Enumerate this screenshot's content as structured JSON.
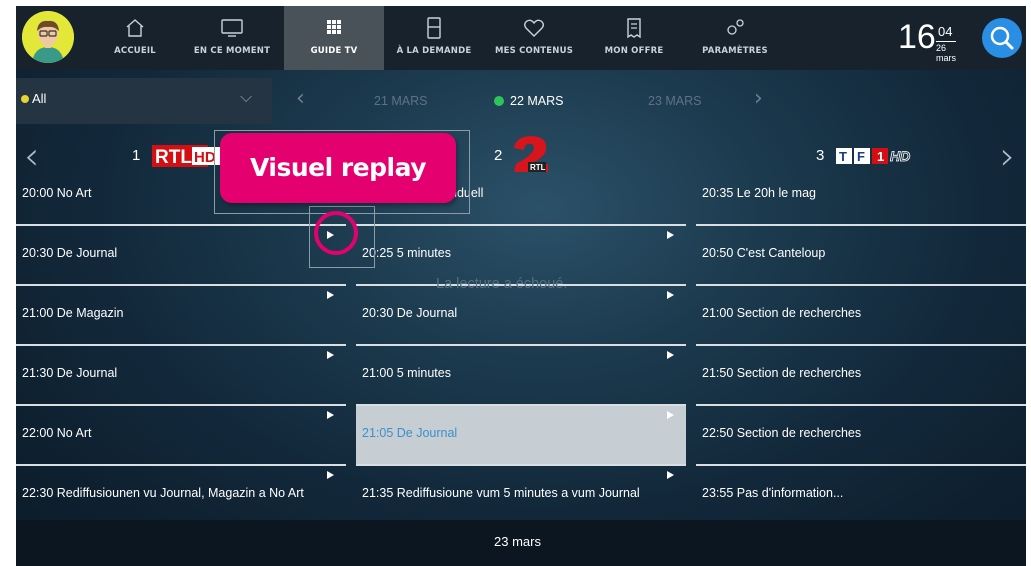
{
  "nav": {
    "items": [
      {
        "label": "ACCUEIL",
        "icon": "home-icon"
      },
      {
        "label": "EN CE MOMENT",
        "icon": "tv-icon"
      },
      {
        "label": "GUIDE TV",
        "icon": "grid-icon",
        "active": true
      },
      {
        "label": "À LA DEMANDE",
        "icon": "film-icon"
      },
      {
        "label": "MES CONTENUS",
        "icon": "heart-icon"
      },
      {
        "label": "MON OFFRE",
        "icon": "receipt-icon"
      },
      {
        "label": "PARAMÈTRES",
        "icon": "gears-icon"
      }
    ],
    "clock": {
      "hours": "16",
      "minutes": "04",
      "date": "26 mars"
    }
  },
  "filter": {
    "value": "All"
  },
  "dates": {
    "prev": "21 MARS",
    "current": "22 MARS",
    "next": "23 MARS"
  },
  "channels": [
    {
      "number": "1",
      "logo": "RTL HD"
    },
    {
      "number": "2",
      "logo": "2 RTL"
    },
    {
      "number": "3",
      "logo": "TF1 HD"
    }
  ],
  "schedule": {
    "col1": [
      {
        "text": "20:00  No Art"
      },
      {
        "text": "20:30  De Journal"
      },
      {
        "text": "21:00  De Magazin"
      },
      {
        "text": "21:30  De Journal"
      },
      {
        "text": "22:00  No Art"
      },
      {
        "text": "22:30  Rediffusiounen vu Journal, Magazin a No Art"
      }
    ],
    "col2": [
      {
        "text": "nduell"
      },
      {
        "text": "20:25  5 minutes"
      },
      {
        "text": "20:30  De Journal"
      },
      {
        "text": "21:00  5 minutes"
      },
      {
        "text": "21:05  De Journal"
      },
      {
        "text": "21:35  Rediffusioune vum 5 minutes a vum Journal"
      }
    ],
    "col3": [
      {
        "text": "20:35  Le 20h le mag"
      },
      {
        "text": "20:50  C'est Canteloup"
      },
      {
        "text": "21:00  Section de recherches"
      },
      {
        "text": "21:50  Section de recherches"
      },
      {
        "text": "22:50  Section de recherches"
      },
      {
        "text": "23:55  Pas d'information..."
      }
    ]
  },
  "playback_message": "La lecture a échoué.",
  "bottom_date": "23 mars",
  "annotation": {
    "label": "Visuel replay"
  },
  "colors": {
    "accent": "#e4006f",
    "search": "#2a8fe4",
    "selected_dot": "#2ec45a",
    "all_dot": "#e5d52e"
  }
}
